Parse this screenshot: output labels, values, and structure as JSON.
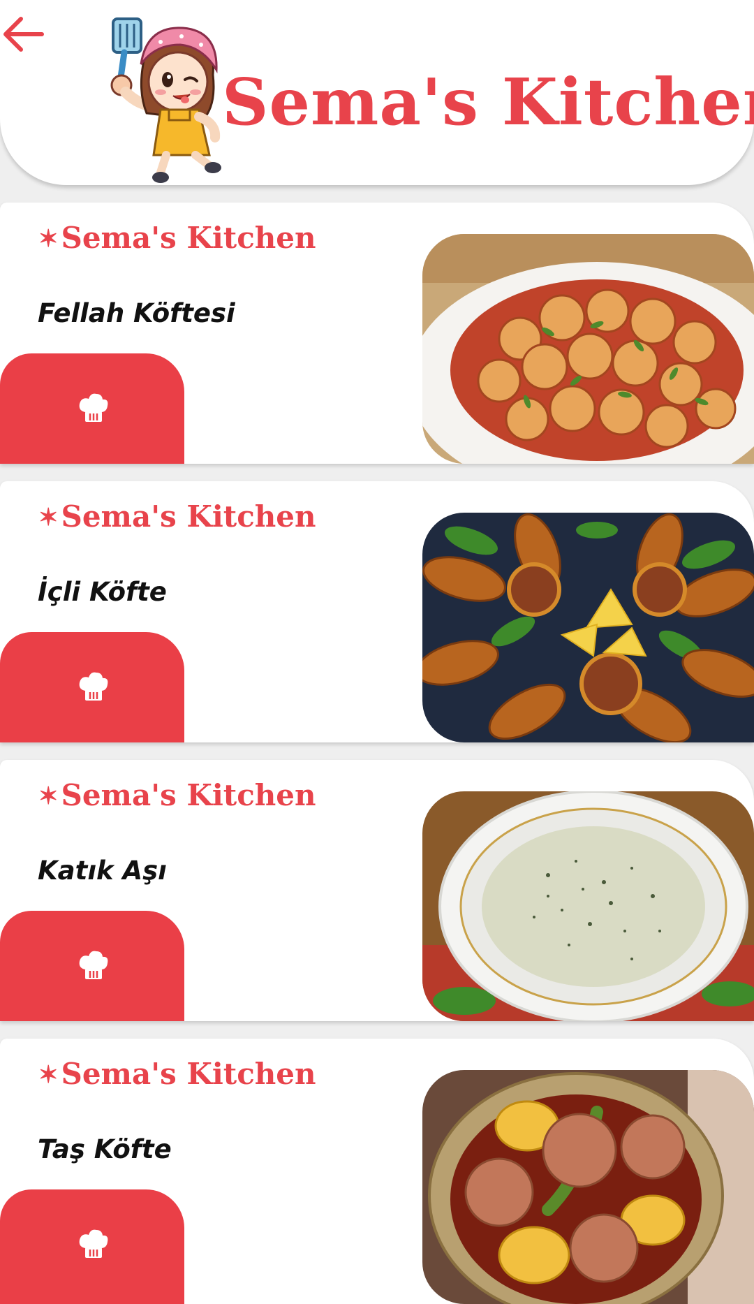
{
  "header": {
    "title": "Sema's Kitchen",
    "back_icon": "arrow-left-icon",
    "mascot": "chef-girl-mascot"
  },
  "colors": {
    "brand": "#e8434b",
    "action": "#ea3f47",
    "background": "#efefef",
    "card": "#ffffff",
    "title_text": "#111111"
  },
  "recipes": [
    {
      "brand": "Sema's Kitchen",
      "title": "Fellah Köftesi",
      "icon": "chef-hat-icon",
      "image": "fellah-koftesi-photo"
    },
    {
      "brand": "Sema's Kitchen",
      "title": "İçli Köfte",
      "icon": "chef-hat-icon",
      "image": "icli-kofte-photo"
    },
    {
      "brand": "Sema's Kitchen",
      "title": "Katık Aşı",
      "icon": "chef-hat-icon",
      "image": "katik-asi-photo"
    },
    {
      "brand": "Sema's Kitchen",
      "title": "Taş Köfte",
      "icon": "chef-hat-icon",
      "image": "tas-kofte-photo"
    }
  ]
}
